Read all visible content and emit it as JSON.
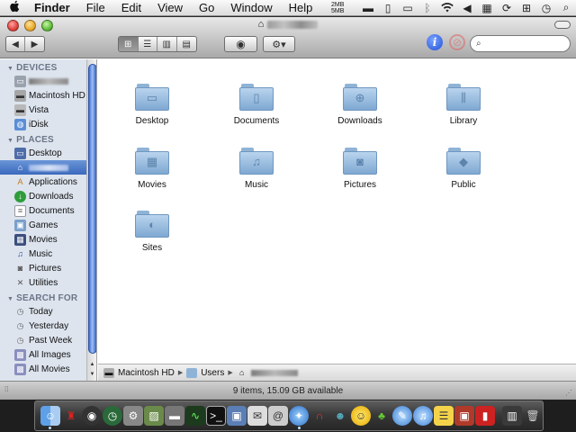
{
  "menubar": {
    "apple": "",
    "items": [
      "Finder",
      "File",
      "Edit",
      "View",
      "Go",
      "Window",
      "Help"
    ],
    "memory": [
      "2MB",
      "5MB"
    ]
  },
  "window": {
    "title_blurred": true,
    "search": {
      "placeholder": ""
    }
  },
  "sidebar": {
    "devices_header": "DEVICES",
    "devices": [
      {
        "label": "",
        "icon": "computer-icon",
        "blurred": true
      },
      {
        "label": "Macintosh HD",
        "icon": "hard-drive-icon"
      },
      {
        "label": "Vista",
        "icon": "disk-icon"
      },
      {
        "label": "iDisk",
        "icon": "idisk-icon"
      }
    ],
    "places_header": "PLACES",
    "places": [
      {
        "label": "Desktop",
        "icon": "desktop-icon"
      },
      {
        "label": "",
        "icon": "home-icon",
        "blurred": true,
        "selected": true
      },
      {
        "label": "Applications",
        "icon": "applications-icon"
      },
      {
        "label": "Downloads",
        "icon": "downloads-icon"
      },
      {
        "label": "Documents",
        "icon": "documents-icon"
      },
      {
        "label": "Games",
        "icon": "games-icon"
      },
      {
        "label": "Movies",
        "icon": "movies-icon"
      },
      {
        "label": "Music",
        "icon": "music-icon"
      },
      {
        "label": "Pictures",
        "icon": "pictures-icon"
      },
      {
        "label": "Utilities",
        "icon": "utilities-icon"
      }
    ],
    "search_header": "SEARCH FOR",
    "searches": [
      {
        "label": "Today",
        "icon": "clock-icon"
      },
      {
        "label": "Yesterday",
        "icon": "clock-icon"
      },
      {
        "label": "Past Week",
        "icon": "clock-icon"
      },
      {
        "label": "All Images",
        "icon": "images-icon"
      },
      {
        "label": "All Movies",
        "icon": "movies-icon"
      }
    ]
  },
  "folders": [
    {
      "label": "Desktop",
      "icon": "desktop-folder-icon"
    },
    {
      "label": "Documents",
      "icon": "documents-folder-icon"
    },
    {
      "label": "Downloads",
      "icon": "downloads-folder-icon"
    },
    {
      "label": "Library",
      "icon": "library-folder-icon"
    },
    {
      "label": "Movies",
      "icon": "movies-folder-icon"
    },
    {
      "label": "Music",
      "icon": "music-folder-icon"
    },
    {
      "label": "Pictures",
      "icon": "pictures-folder-icon"
    },
    {
      "label": "Public",
      "icon": "public-folder-icon"
    },
    {
      "label": "Sites",
      "icon": "sites-folder-icon"
    }
  ],
  "pathbar": {
    "disk": "Macintosh HD",
    "users": "Users"
  },
  "status": "9 items, 15.09 GB available",
  "colors": {
    "selection": "#3b69bd",
    "sidebar_bg": "#dde4ee",
    "folder_blue": "#8fb3d6"
  }
}
